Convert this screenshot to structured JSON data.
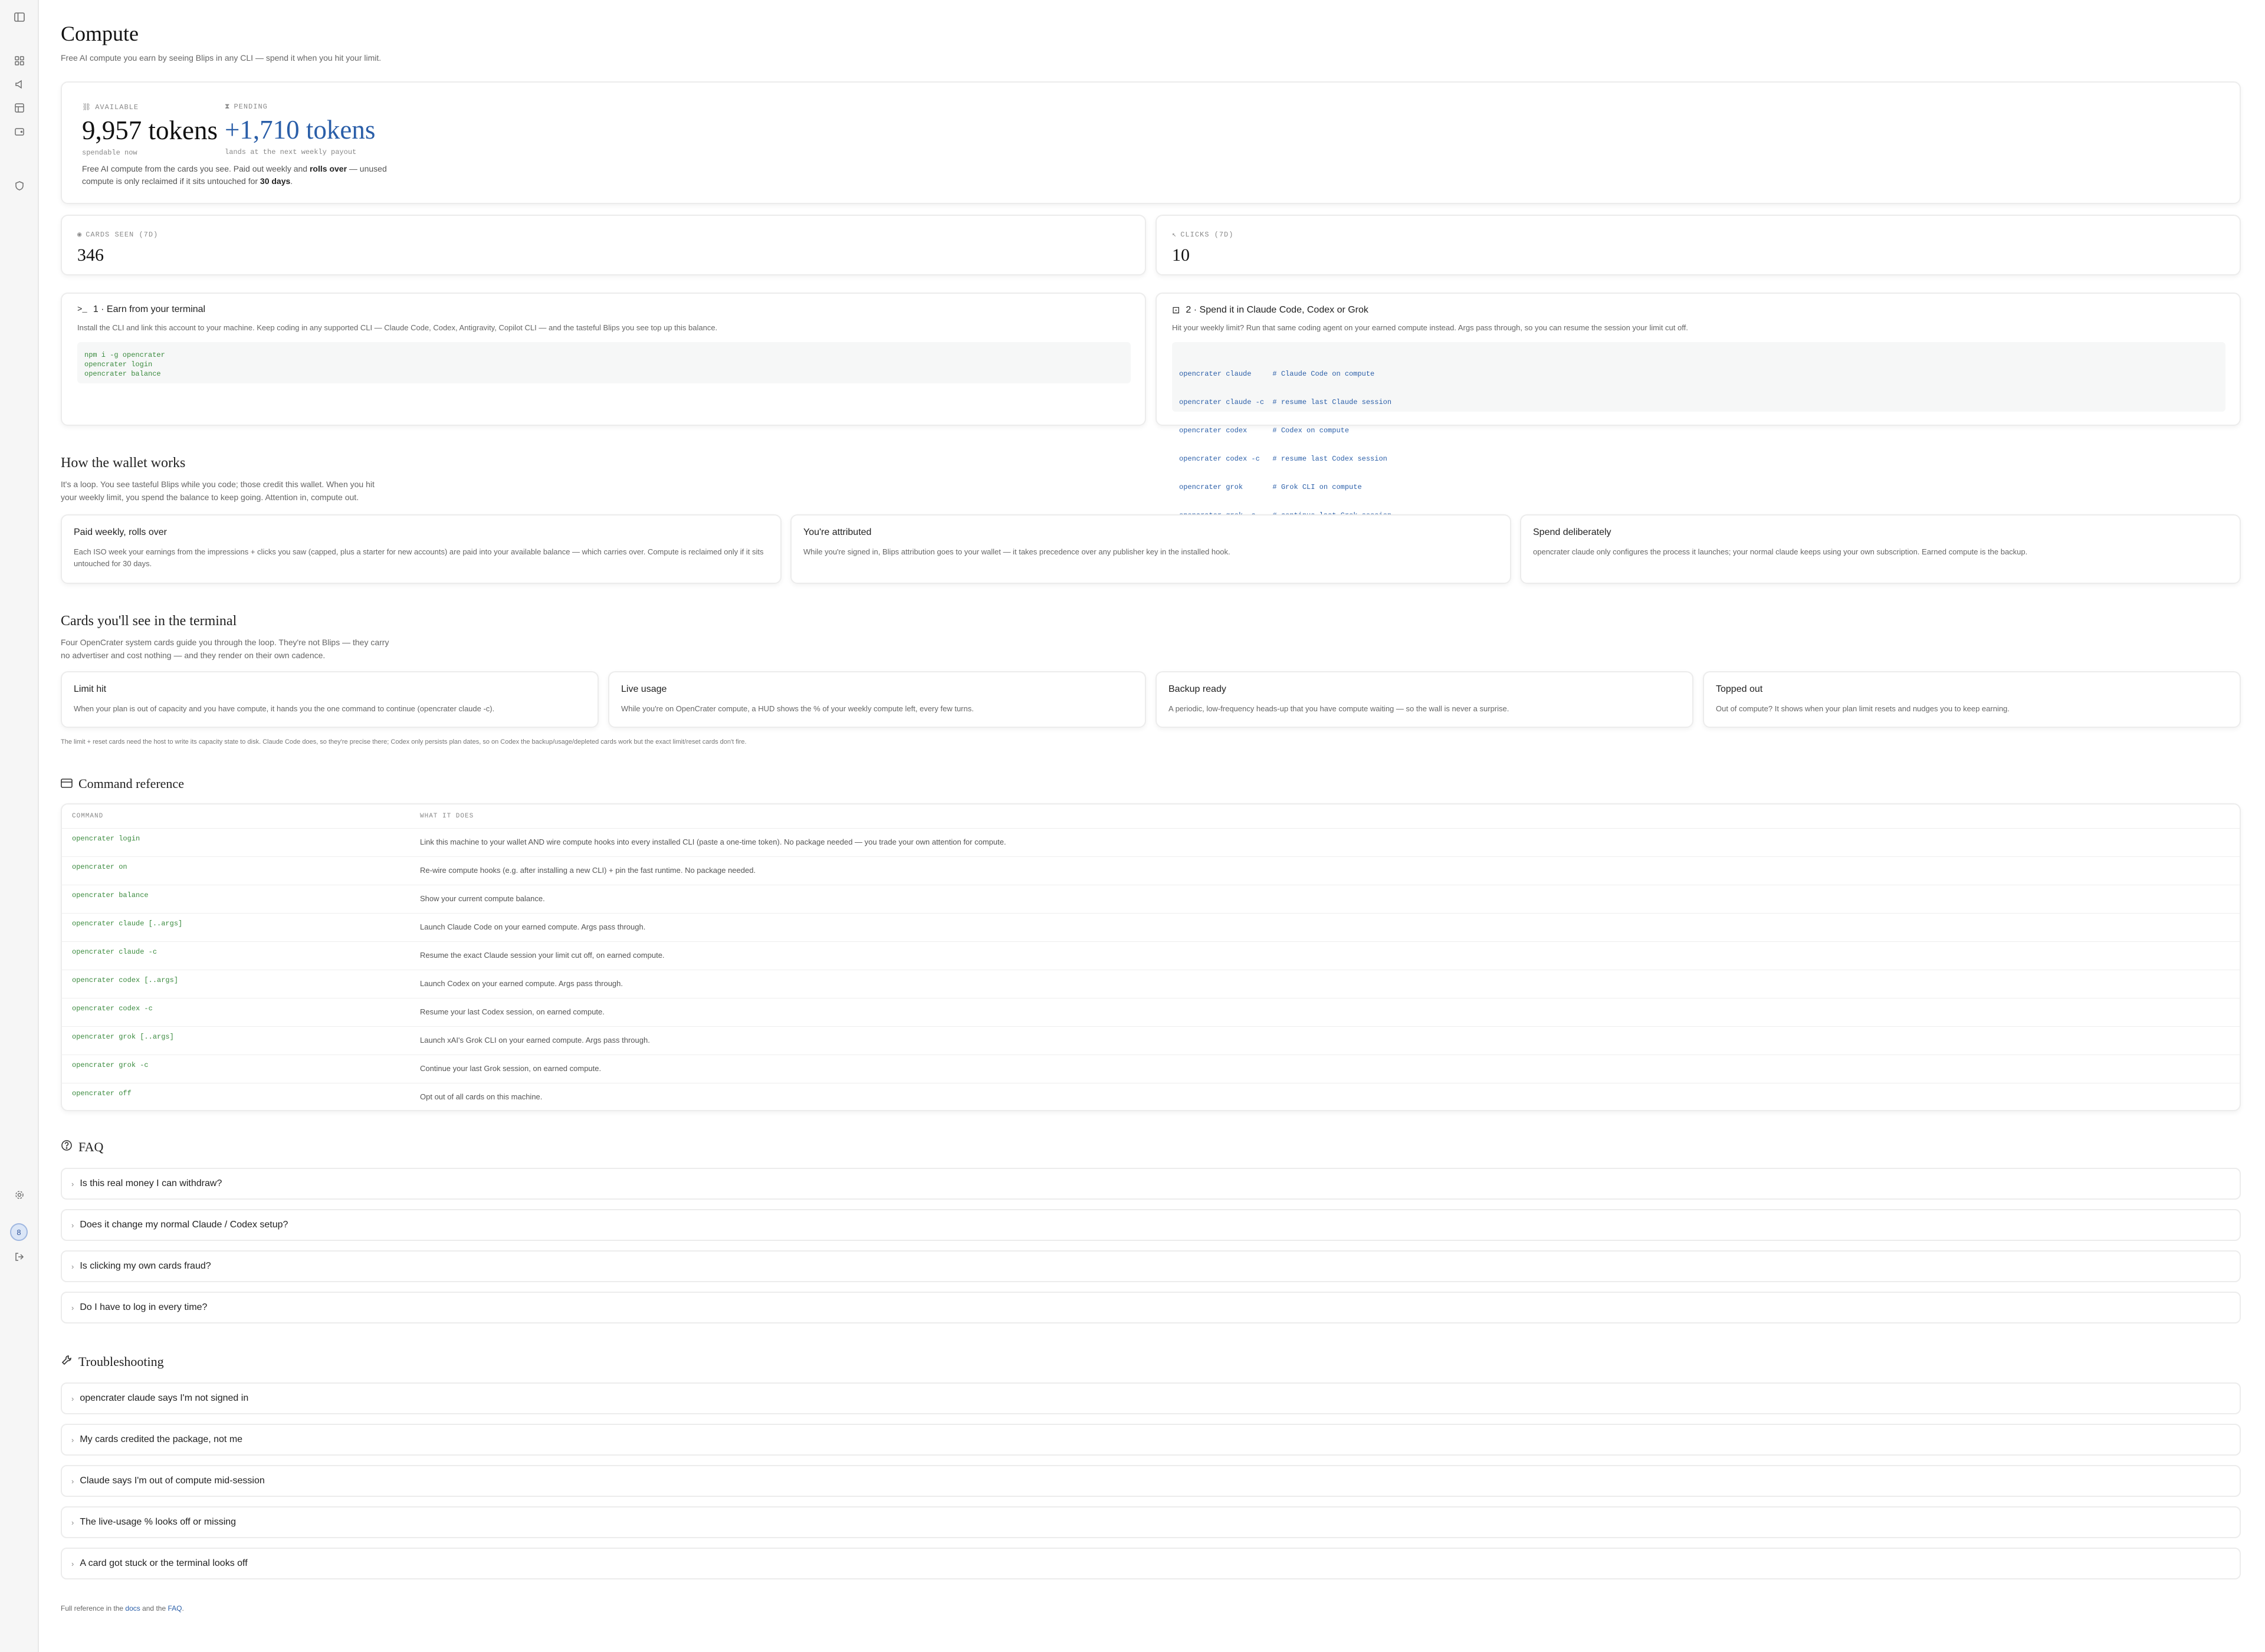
{
  "sidebar": {
    "icons": [
      "sidebar-toggle-icon",
      "grid-icon",
      "megaphone-icon",
      "layout-icon",
      "wallet-icon",
      "shield-icon",
      "gear-icon",
      "logout-icon"
    ],
    "avatar": "8"
  },
  "header": {
    "title": "Compute",
    "subtitle": "Free AI compute you earn by seeing Blips in any CLI — spend it when you hit your limit."
  },
  "balance": {
    "available_label": "AVAILABLE",
    "available_value": "9,957 tokens",
    "available_note": "spendable now",
    "pending_label": "PENDING",
    "pending_value": "+1,710 tokens",
    "pending_note": "lands at the next weekly payout",
    "description_1": "Free AI compute from the cards you see. Paid out weekly and ",
    "description_bold_1": "rolls over",
    "description_2": " — unused compute is only reclaimed if it sits untouched for ",
    "description_bold_2": "30 days",
    "description_3": "."
  },
  "stats": {
    "cards_label": "CARDS SEEN (7D)",
    "cards_value": "346",
    "clicks_label": "CLICKS (7D)",
    "clicks_value": "10"
  },
  "steps": {
    "earn_title": "1 · Earn from your terminal",
    "earn_body": "Install the CLI and link this account to your machine. Keep coding in any supported CLI — Claude Code, Codex, Antigravity, Copilot CLI — and the tasteful Blips you see top up this balance.",
    "earn_code": [
      "npm i -g opencrater",
      "opencrater login",
      "opencrater balance"
    ],
    "spend_title": "2 · Spend it in Claude Code, Codex or Grok",
    "spend_body": "Hit your weekly limit? Run that same coding agent on your earned compute instead. Args pass through, so you can resume the session your limit cut off.",
    "spend_code": [
      {
        "cmd": "opencrater claude   ",
        "comment": "  # Claude Code on compute"
      },
      {
        "cmd": "opencrater claude -c",
        "comment": "  # resume last Claude session"
      },
      {
        "cmd": "opencrater codex    ",
        "comment": "  # Codex on compute"
      },
      {
        "cmd": "opencrater codex -c ",
        "comment": "  # resume last Codex session"
      },
      {
        "cmd": "opencrater grok     ",
        "comment": "  # Grok CLI on compute"
      },
      {
        "cmd": "opencrater grok -c  ",
        "comment": "  # continue last Grok session"
      }
    ]
  },
  "wallet": {
    "title": "How the wallet works",
    "subtitle": "It's a loop. You see tasteful Blips while you code; those credit this wallet. When you hit your weekly limit, you spend the balance to keep going. Attention in, compute out.",
    "cards": [
      {
        "title": "Paid weekly, rolls over",
        "body": "Each ISO week your earnings from the impressions + clicks you saw (capped, plus a starter for new accounts) are paid into your available balance — which carries over. Compute is reclaimed only if it sits untouched for 30 days."
      },
      {
        "title": "You're attributed",
        "body": "While you're signed in, Blips attribution goes to your wallet — it takes precedence over any publisher key in the installed hook."
      },
      {
        "title": "Spend deliberately",
        "body": "opencrater claude only configures the process it launches; your normal claude keeps using your own subscription. Earned compute is the backup."
      }
    ]
  },
  "terminal_cards": {
    "title": "Cards you'll see in the terminal",
    "subtitle": "Four OpenCrater system cards guide you through the loop. They're not Blips — they carry no advertiser and cost nothing — and they render on their own cadence.",
    "cards": [
      {
        "title": "Limit hit",
        "body": "When your plan is out of capacity and you have compute, it hands you the one command to continue (opencrater claude -c)."
      },
      {
        "title": "Live usage",
        "body": "While you're on OpenCrater compute, a HUD shows the % of your weekly compute left, every few turns."
      },
      {
        "title": "Backup ready",
        "body": "A periodic, low-frequency heads-up that you have compute waiting — so the wall is never a surprise."
      },
      {
        "title": "Topped out",
        "body": "Out of compute? It shows when your plan limit resets and nudges you to keep earning."
      }
    ],
    "footnote": "The limit + reset cards need the host to write its capacity state to disk. Claude Code does, so they're precise there; Codex only persists plan dates, so on Codex the backup/usage/depleted cards work but the exact limit/reset cards don't fire."
  },
  "commands": {
    "title": "Command reference",
    "col_command": "COMMAND",
    "col_desc": "WHAT IT DOES",
    "rows": [
      {
        "cmd": "opencrater login",
        "desc": "Link this machine to your wallet AND wire compute hooks into every installed CLI (paste a one-time token). No package needed — you trade your own attention for compute."
      },
      {
        "cmd": "opencrater on",
        "desc": "Re-wire compute hooks (e.g. after installing a new CLI) + pin the fast runtime. No package needed."
      },
      {
        "cmd": "opencrater balance",
        "desc": "Show your current compute balance."
      },
      {
        "cmd": "opencrater claude [..args]",
        "desc": "Launch Claude Code on your earned compute. Args pass through."
      },
      {
        "cmd": "opencrater claude -c",
        "desc": "Resume the exact Claude session your limit cut off, on earned compute."
      },
      {
        "cmd": "opencrater codex [..args]",
        "desc": "Launch Codex on your earned compute. Args pass through."
      },
      {
        "cmd": "opencrater codex -c",
        "desc": "Resume your last Codex session, on earned compute."
      },
      {
        "cmd": "opencrater grok [..args]",
        "desc": "Launch xAI's Grok CLI on your earned compute. Args pass through."
      },
      {
        "cmd": "opencrater grok -c",
        "desc": "Continue your last Grok session, on earned compute."
      },
      {
        "cmd": "opencrater off",
        "desc": "Opt out of all cards on this machine."
      }
    ]
  },
  "faq": {
    "title": "FAQ",
    "items": [
      "Is this real money I can withdraw?",
      "Does it change my normal Claude / Codex setup?",
      "Is clicking my own cards fraud?",
      "Do I have to log in every time?"
    ]
  },
  "troubleshooting": {
    "title": "Troubleshooting",
    "items": [
      "opencrater claude says I'm not signed in",
      "My cards credited the package, not me",
      "Claude says I'm out of compute mid-session",
      "The live-usage % looks off or missing",
      "A card got stuck or the terminal looks off"
    ]
  },
  "footer": {
    "prefix": "Full reference in the ",
    "docs": "docs",
    "mid": " and the ",
    "faq": "FAQ",
    "suffix": "."
  }
}
